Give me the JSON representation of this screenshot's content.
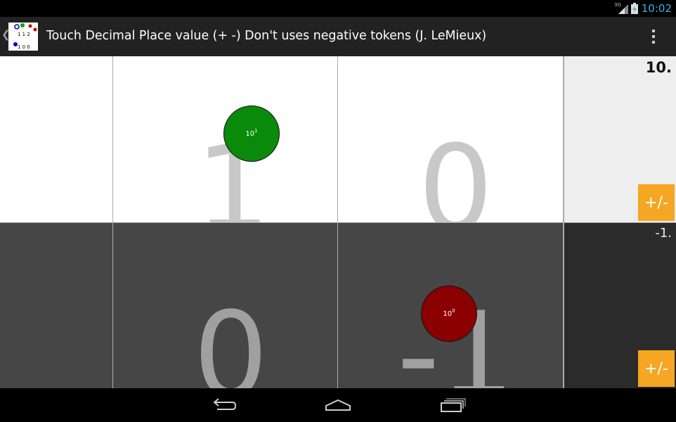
{
  "status_bar": {
    "time": "10:02",
    "network": "3G"
  },
  "action_bar": {
    "title": "Touch Decimal Place value (+ -) Don't uses negative tokens (J. LeMieux)",
    "icon": {
      "top_digits": "1 1 2",
      "bottom_digits": "1 0 0"
    }
  },
  "board": {
    "positive_row": {
      "digits": [
        "",
        "1",
        "0"
      ],
      "total": "10.",
      "sign_button": "+/-",
      "token": {
        "base": "10",
        "exponent": "1",
        "color": "#0a8a0a"
      }
    },
    "negative_row": {
      "digits": [
        "",
        "0",
        "-1"
      ],
      "total": "-1.",
      "sign_button": "+/-",
      "token": {
        "base": "10",
        "exponent": "0",
        "color": "#8b0000"
      }
    }
  },
  "colors": {
    "accent_orange": "#f5a623",
    "status_time": "#33b5e5"
  },
  "nav_bar": {
    "icons": [
      "back-icon",
      "home-icon",
      "recent-apps-icon"
    ]
  }
}
